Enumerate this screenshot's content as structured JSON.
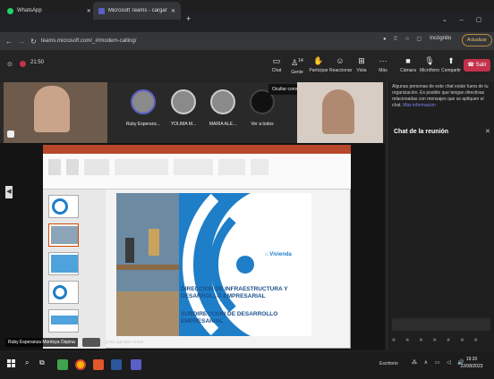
{
  "browser": {
    "tabs": [
      {
        "label": "WhatsApp"
      },
      {
        "label": "Microsoft Teams - cargando"
      }
    ],
    "url": "teams.microsoft.com/_#/modern-calling/",
    "profile_label": "Incógnito",
    "update_label": "Actualizar"
  },
  "teams": {
    "call_timer": "21:50",
    "toolbar": [
      {
        "label": "Chat",
        "icon": "chat-icon"
      },
      {
        "label": "Gente",
        "icon": "people-icon",
        "count": "14"
      },
      {
        "label": "Participar",
        "icon": "raise-hand-icon"
      },
      {
        "label": "Reaccionar",
        "icon": "emoji-icon"
      },
      {
        "label": "Vista",
        "icon": "view-icon"
      },
      {
        "label": "Más",
        "icon": "more-icon"
      },
      {
        "label": "Cámara",
        "icon": "camera-icon"
      },
      {
        "label": "Micrófono",
        "icon": "mic-icon"
      },
      {
        "label": "Compartir",
        "icon": "share-icon"
      }
    ],
    "leave_label": "Salir",
    "hide_conversation": "Ocultar conversación"
  },
  "participants": [
    {
      "name": "Ruby Esperanz..."
    },
    {
      "name": "YOLIMA M..."
    },
    {
      "name": "MARIA ALE..."
    },
    {
      "name": "Ver a todos"
    }
  ],
  "chat_panel": {
    "notice": "Algunas personas de este chat están fuera de tu organización. Es posible que tengan directivas relacionadas con mensajes que se apliquen al chat.",
    "more_info": "Más información",
    "title": "Chat de la reunión"
  },
  "presenter": {
    "name": "Ruby Esperanza Montoya Ospina",
    "add_note": "...para agregar notas"
  },
  "slide": {
    "logo_text": "Vivienda",
    "heading": "DIRECCION DE INFRAESTRUCTURA Y DESARROLLO EMPRESARIAL",
    "subheading": "SUBDIRECCION DE DESARROLLO EMPRESARIAL"
  },
  "taskbar": {
    "desktop_label": "Escritorio",
    "time": "19:20",
    "date": "22/08/2023"
  },
  "colors": {
    "brand_blue": "#1e7ec8",
    "teams_dark": "#242424",
    "leave_red": "#c4314b",
    "ppt_red": "#b7472a"
  }
}
